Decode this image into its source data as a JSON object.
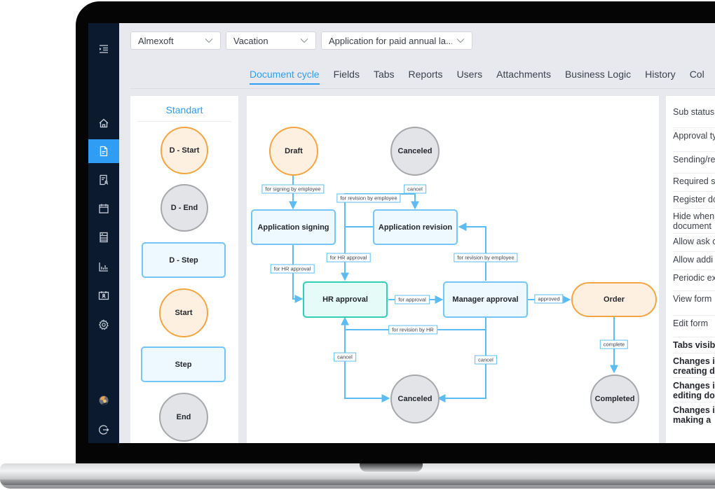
{
  "sidebar": {
    "items": [
      {
        "name": "menu-collapse",
        "icon": "indent-icon",
        "active": false
      },
      {
        "name": "home",
        "icon": "home-icon",
        "active": false
      },
      {
        "name": "documents",
        "icon": "document-icon",
        "active": true
      },
      {
        "name": "document-user",
        "icon": "document-user-icon",
        "active": false
      },
      {
        "name": "calendar",
        "icon": "calendar-icon",
        "active": false
      },
      {
        "name": "registry",
        "icon": "list-icon",
        "active": false
      },
      {
        "name": "reports",
        "icon": "bar-chart-icon",
        "active": false
      },
      {
        "name": "id-card",
        "icon": "id-card-icon",
        "active": false
      },
      {
        "name": "settings",
        "icon": "gear-icon",
        "active": false
      },
      {
        "name": "user-avatar",
        "icon": "avatar-icon",
        "active": false
      },
      {
        "name": "logout",
        "icon": "logout-icon",
        "active": false
      }
    ]
  },
  "selects": {
    "company": "Almexoft",
    "category": "Vacation",
    "document_type": "Application for paid annual la..."
  },
  "tabs": [
    {
      "label": "Document cycle",
      "active": true
    },
    {
      "label": "Fields",
      "active": false
    },
    {
      "label": "Tabs",
      "active": false
    },
    {
      "label": "Reports",
      "active": false
    },
    {
      "label": "Users",
      "active": false
    },
    {
      "label": "Attachments",
      "active": false
    },
    {
      "label": "Business Logic",
      "active": false
    },
    {
      "label": "History",
      "active": false
    },
    {
      "label": "Col",
      "active": false
    }
  ],
  "palette": {
    "title": "Standart",
    "items": [
      "D - Start",
      "D - End",
      "D - Step",
      "Start",
      "Step",
      "End"
    ]
  },
  "diagram": {
    "nodes": {
      "draft": "Draft",
      "canceled_top": "Canceled",
      "application_signing": "Application signing",
      "application_revision": "Application revision",
      "hr_approval": "HR approval",
      "manager_approval": "Manager approval",
      "order": "Order",
      "canceled_bottom": "Canceled",
      "completed": "Completed"
    },
    "edges": {
      "for_signing_by_employee": "for signing by employee",
      "cancel_top": "cancel",
      "for_revision_by_employee_top": "for revision by employee",
      "for_hr_approval_left": "for HR approval",
      "for_hr_approval_mid": "for HR approval",
      "for_revision_by_employee_right": "for revision by employee",
      "for_approval": "for approval",
      "approved": "approved",
      "for_revision_by_hr": "for revision by HR",
      "cancel_left": "cancel",
      "cancel_right": "cancel",
      "complete": "complete"
    }
  },
  "properties": [
    {
      "label": "Sub status",
      "bold": false
    },
    {
      "label": "Approval ty",
      "bold": false
    },
    {
      "label": "Sending/re",
      "bold": false
    },
    {
      "label": "Required s",
      "bold": false
    },
    {
      "label": "Register dc",
      "bold": false
    },
    {
      "label": "Hide when\ndocument",
      "bold": false
    },
    {
      "label": "Allow ask c",
      "bold": false
    },
    {
      "label": "Allow addi",
      "bold": false
    },
    {
      "label": "Periodic ex",
      "bold": false
    },
    {
      "label": "View form",
      "bold": false
    },
    {
      "label": "Edit form",
      "bold": false
    },
    {
      "label": "Tabs visib",
      "bold": true
    },
    {
      "label": "Changes i\ncreating d",
      "bold": true
    },
    {
      "label": "Changes i\nediting do",
      "bold": true
    },
    {
      "label": "Changes i\nmaking a",
      "bold": true
    }
  ],
  "colors": {
    "accent": "#2f9df4",
    "sidebar_bg": "#0b1a2e",
    "start_fill": "#fdf0e0",
    "start_stroke": "#f2a541",
    "end_fill": "#e3e4e8",
    "end_stroke": "#a6a8ad",
    "step_fill": "#eef8ff",
    "step_stroke": "#75c5f5",
    "active_step_fill": "#e5fbf7",
    "active_step_stroke": "#33cdb7",
    "edge": "#5cbcf2"
  }
}
